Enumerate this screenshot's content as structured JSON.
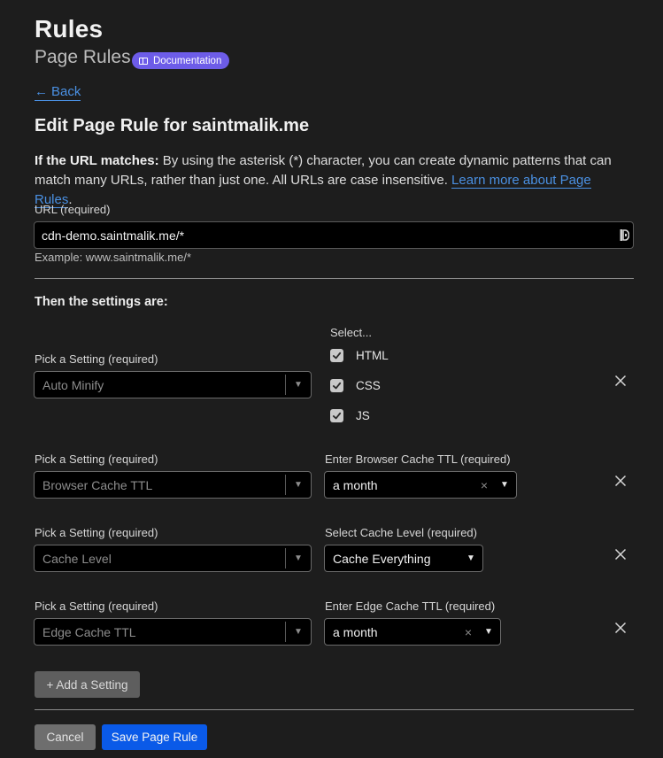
{
  "header": {
    "title": "Rules",
    "subtitle": "Page Rules",
    "doc_badge": "Documentation"
  },
  "back": {
    "arrow": "←",
    "label": "Back"
  },
  "form": {
    "title": "Edit Page Rule for saintmalik.me",
    "desc_bold": "If the URL matches:",
    "desc_text": " By using the asterisk (*) character, you can create dynamic patterns that can match many URLs, rather than just one. All URLs are case insensitive. ",
    "desc_link": "Learn more about Page Rules",
    "desc_end": ".",
    "url_label": "URL (required)",
    "url_value": "cdn-demo.saintmalik.me/*",
    "url_example": "Example: www.saintmalik.me/*",
    "then_label": "Then the settings are:"
  },
  "settings": [
    {
      "pick_label": "Pick a Setting (required)",
      "setting": "Auto Minify",
      "select_label": "Select...",
      "checkboxes": [
        {
          "label": "HTML",
          "checked": true
        },
        {
          "label": "CSS",
          "checked": true
        },
        {
          "label": "JS",
          "checked": true
        }
      ]
    },
    {
      "pick_label": "Pick a Setting (required)",
      "setting": "Browser Cache TTL",
      "value_label": "Enter Browser Cache TTL (required)",
      "value": "a month",
      "clear": "×"
    },
    {
      "pick_label": "Pick a Setting (required)",
      "setting": "Cache Level",
      "value_label": "Select Cache Level (required)",
      "value": "Cache Everything"
    },
    {
      "pick_label": "Pick a Setting (required)",
      "setting": "Edge Cache TTL",
      "value_label": "Enter Edge Cache TTL (required)",
      "value": "a month",
      "clear": "×"
    }
  ],
  "buttons": {
    "add": "+ Add a Setting",
    "cancel": "Cancel",
    "save": "Save Page Rule"
  },
  "icons": {
    "caret": "▼",
    "check": "check-icon",
    "remove": "close-icon",
    "badge": "book-icon",
    "url_tool": "password-manager-icon"
  },
  "colors": {
    "accent_link": "#4a90e2",
    "badge": "#6d5ce8",
    "primary_button": "#0a5ae8"
  }
}
